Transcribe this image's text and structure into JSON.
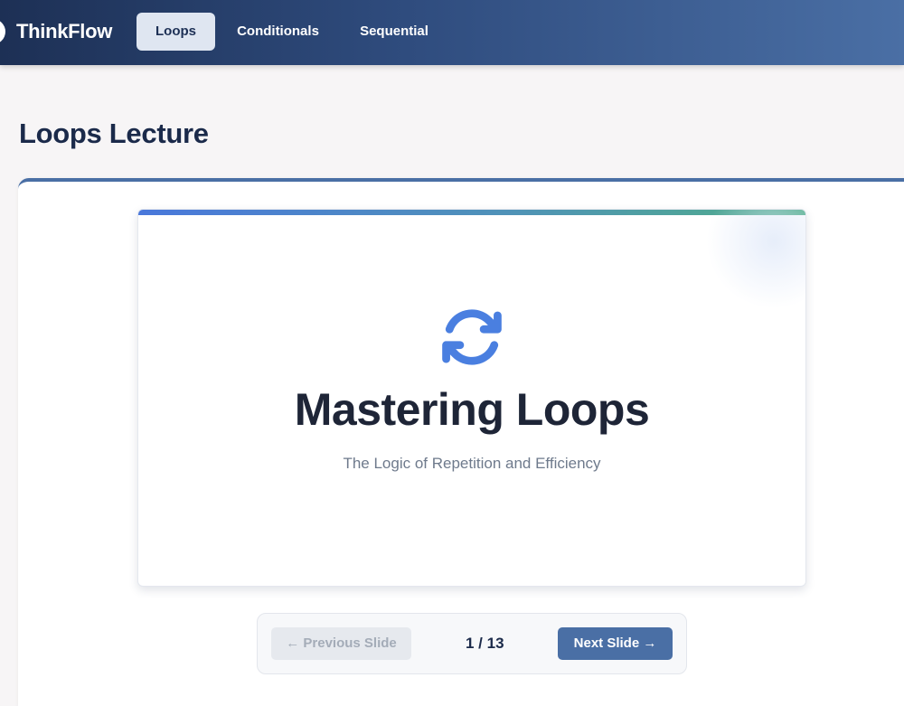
{
  "header": {
    "brand": "ThinkFlow",
    "tabs": [
      {
        "label": "Loops",
        "active": true
      },
      {
        "label": "Conditionals",
        "active": false
      },
      {
        "label": "Sequential",
        "active": false
      }
    ]
  },
  "page": {
    "title": "Loops Lecture"
  },
  "slide": {
    "icon": "loop-refresh-icon",
    "title": "Mastering Loops",
    "subtitle": "The Logic of Repetition and Efficiency"
  },
  "slide_nav": {
    "prev_label": "← Previous Slide",
    "next_label": "Next Slide →",
    "counter": "1 / 13"
  },
  "colors": {
    "header_dark": "#1d3055",
    "header_light": "#4a6fa5",
    "accent_blue": "#4a78db",
    "accent_green": "#4fae88",
    "primary_button": "#4a6fa5"
  }
}
